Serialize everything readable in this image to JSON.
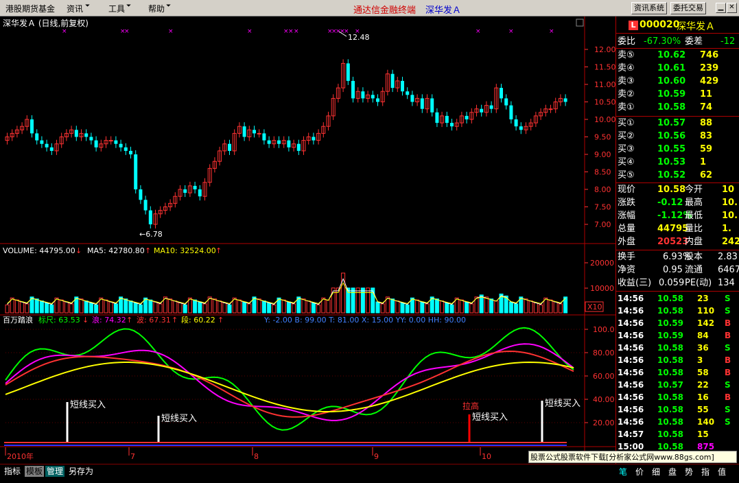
{
  "menu": {
    "items": [
      "港股期货基金",
      "资讯",
      "工具",
      "帮助"
    ],
    "app_title": "通达信金融终端",
    "stock_title": "深华发Ａ",
    "buttons": [
      "资讯系统",
      "委托交易"
    ]
  },
  "colors": {
    "up": "#ff3232",
    "down": "#00ffff",
    "grid": "#800000",
    "axis": "#ff3232",
    "white": "#ffffff",
    "yellow": "#ffff00",
    "magenta": "#ff00ff",
    "green": "#00ff00"
  },
  "price_panel": {
    "header": "深华发Ａ (日线,前复权)",
    "y_ticks": [
      "12.00",
      "11.50",
      "11.00",
      "10.50",
      "10.00",
      "9.50",
      "9.00",
      "8.50",
      "8.00",
      "7.50",
      "7.00"
    ],
    "high_label": "12.48",
    "low_label": "6.78"
  },
  "volume_panel": {
    "volume_label": "VOLUME: 44795.00",
    "ma5_label": "MA5: 42780.80",
    "ma10_label": "MA10: 32524.00",
    "y_ticks": [
      "20000",
      "10000"
    ],
    "multiplier": "X10"
  },
  "indicator_panel": {
    "name": "百万踏浪",
    "labels": [
      {
        "text": "标尺: 63.53",
        "color": "#00ff00"
      },
      {
        "text": "浪: 74.32",
        "color": "#ff00ff"
      },
      {
        "text": "波: 67.31",
        "color": "#ff3232"
      },
      {
        "text": "段: 60.22",
        "color": "#ffff00"
      }
    ],
    "params": "Y: -2.00  B: 99.00  T: 81.00  X: 15.00  YY: 0.00  HH: 90.00",
    "y_ticks": [
      "100.0",
      "80.00",
      "60.00",
      "40.00",
      "20.00"
    ],
    "signals": [
      "短线买入",
      "短线买入",
      "短线买入",
      "短线买入"
    ],
    "red_signal": "拉高"
  },
  "date_axis": [
    "2010年",
    "7",
    "8",
    "9",
    "10"
  ],
  "quote": {
    "code": "000020",
    "name": "深华发Ａ",
    "badge": "L",
    "webi_label": "委比",
    "webi": "-67.30%",
    "weicha_label": "委差",
    "weicha": "-12",
    "sells": [
      {
        "label": "卖⑤",
        "price": "10.62",
        "vol": "746"
      },
      {
        "label": "卖④",
        "price": "10.61",
        "vol": "239"
      },
      {
        "label": "卖③",
        "price": "10.60",
        "vol": "429"
      },
      {
        "label": "卖②",
        "price": "10.59",
        "vol": "11"
      },
      {
        "label": "卖①",
        "price": "10.58",
        "vol": "74"
      }
    ],
    "buys": [
      {
        "label": "买①",
        "price": "10.57",
        "vol": "88"
      },
      {
        "label": "买②",
        "price": "10.56",
        "vol": "83"
      },
      {
        "label": "买③",
        "price": "10.55",
        "vol": "59"
      },
      {
        "label": "买④",
        "price": "10.53",
        "vol": "1"
      },
      {
        "label": "买⑤",
        "price": "10.52",
        "vol": "62"
      }
    ],
    "stats": [
      {
        "l1": "现价",
        "v1": "10.58",
        "c1": "#ffff00",
        "l2": "今开",
        "v2": "10"
      },
      {
        "l1": "涨跌",
        "v1": "-0.12",
        "c1": "#00ff00",
        "l2": "最高",
        "v2": "10."
      },
      {
        "l1": "涨幅",
        "v1": "-1.12%",
        "c1": "#00ff00",
        "l2": "最低",
        "v2": "10."
      },
      {
        "l1": "总量",
        "v1": "44795",
        "c1": "#ffff00",
        "l2": "量比",
        "v2": "1."
      },
      {
        "l1": "外盘",
        "v1": "20523",
        "c1": "#ff3232",
        "l2": "内盘",
        "v2": "242"
      }
    ],
    "stats2": [
      {
        "l1": "换手",
        "v1": "6.93%",
        "l2": "股本",
        "v2": "2.83"
      },
      {
        "l1": "净资",
        "v1": "0.95",
        "l2": "流通",
        "v2": "6467"
      },
      {
        "l1": "收益(三)",
        "v1": "0.059",
        "l2": "PE(动)",
        "v2": "134"
      }
    ],
    "ticks": [
      {
        "t": "14:56",
        "p": "10.58",
        "v": "23",
        "s": "S"
      },
      {
        "t": "14:56",
        "p": "10.58",
        "v": "110",
        "s": "S"
      },
      {
        "t": "14:56",
        "p": "10.59",
        "v": "142",
        "s": "B"
      },
      {
        "t": "14:56",
        "p": "10.59",
        "v": "84",
        "s": "B"
      },
      {
        "t": "14:56",
        "p": "10.58",
        "v": "36",
        "s": "S"
      },
      {
        "t": "14:56",
        "p": "10.58",
        "v": "3",
        "s": "B"
      },
      {
        "t": "14:56",
        "p": "10.58",
        "v": "58",
        "s": "B"
      },
      {
        "t": "14:56",
        "p": "10.57",
        "v": "22",
        "s": "S"
      },
      {
        "t": "14:56",
        "p": "10.58",
        "v": "16",
        "s": "B"
      },
      {
        "t": "14:56",
        "p": "10.58",
        "v": "55",
        "s": "S"
      },
      {
        "t": "14:56",
        "p": "10.58",
        "v": "140",
        "s": "S"
      },
      {
        "t": "14:57",
        "p": "10.58",
        "v": "15",
        "s": ""
      },
      {
        "t": "15:00",
        "p": "10.58",
        "v": "875",
        "s": ""
      }
    ]
  },
  "bottom": {
    "tabs": [
      "指标",
      "模板",
      "管理",
      "另存为"
    ],
    "right_tabs": [
      "笔",
      "价",
      "细",
      "盘",
      "势",
      "指",
      "值"
    ]
  },
  "watermark": "股票公式股票软件下载[分析家公式网www.88gs.com]"
}
